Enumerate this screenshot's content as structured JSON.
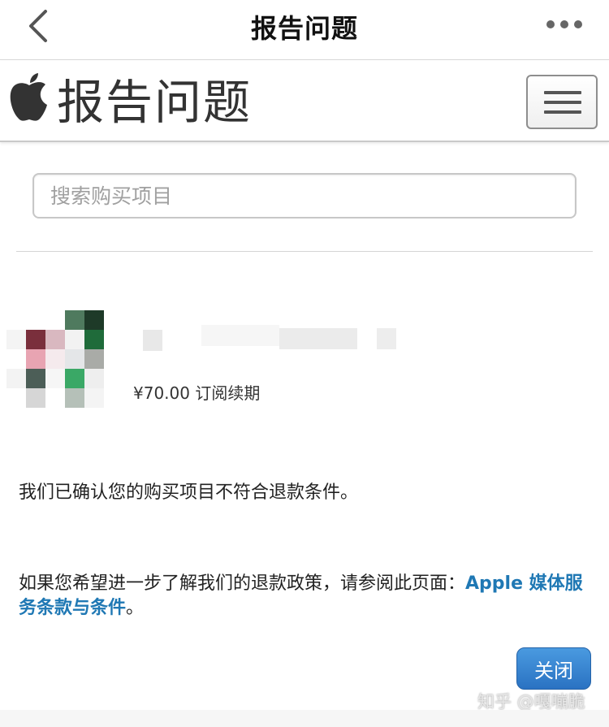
{
  "navbar": {
    "title": "报告问题",
    "back_icon": "chevron-left-icon",
    "more_icon": "more-horizontal-icon"
  },
  "header": {
    "logo_icon": "apple-logo-icon",
    "title": "报告问题",
    "menu_icon": "hamburger-menu-icon"
  },
  "search": {
    "placeholder": "搜索购买项目",
    "value": ""
  },
  "purchase": {
    "price_text": "¥70.00 订阅续期"
  },
  "message": {
    "text": "我们已确认您的购买项目不符合退款条件。"
  },
  "refund_info": {
    "text_before": "如果您希望进一步了解我们的退款政策，请参阅此页面：",
    "link_text": "Apple 媒体服务条款与条件",
    "text_after": "。"
  },
  "close_button": {
    "label": "关闭"
  },
  "watermark": {
    "text": "知乎 @嘎嘣脆"
  },
  "colors": {
    "link": "#1f78b4",
    "button": "#3b87d4",
    "border": "#c7c7c7"
  }
}
